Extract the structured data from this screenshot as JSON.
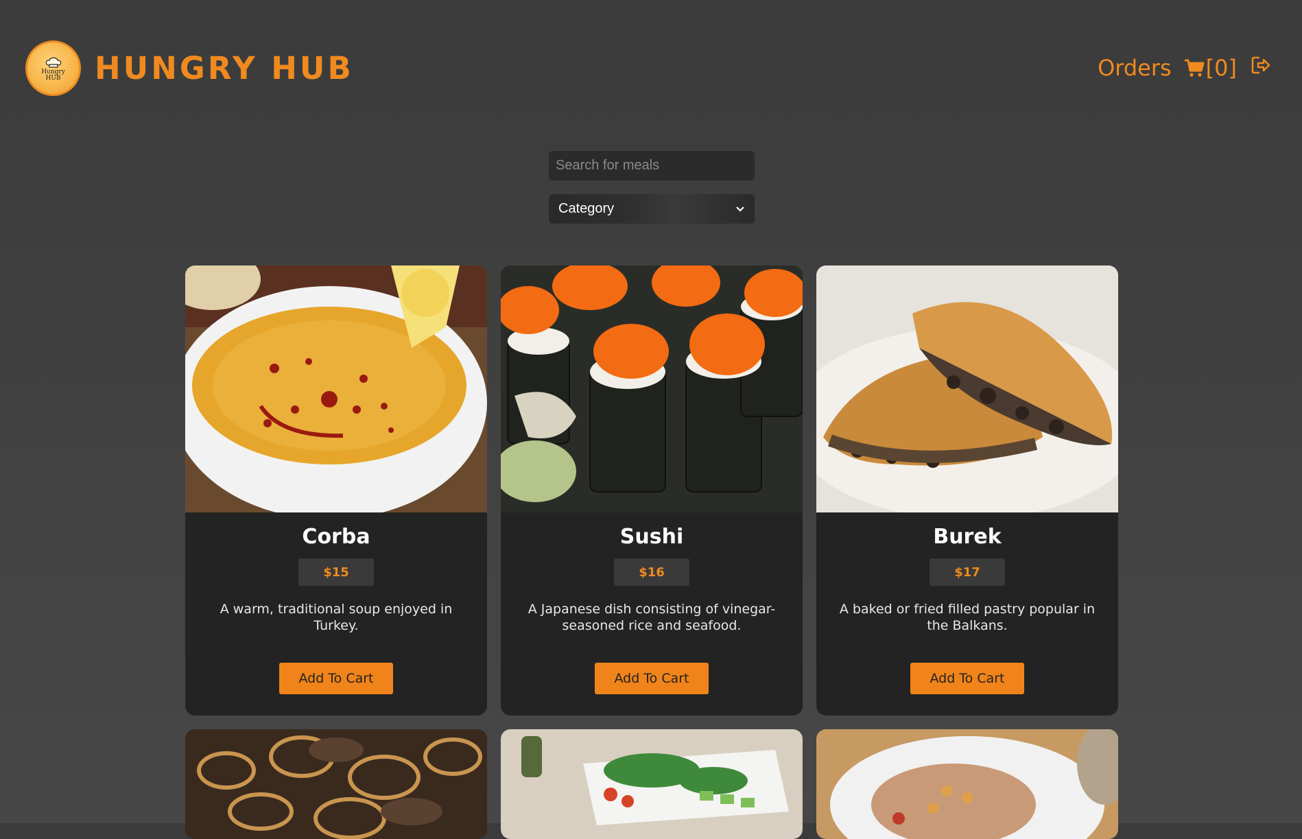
{
  "brand": {
    "title": "HUNGRY HUB",
    "logo_text_1": "Hungry",
    "logo_text_2": "HUB"
  },
  "nav": {
    "orders_label": "Orders",
    "cart_count": "[0]"
  },
  "search": {
    "placeholder": "Search for meals",
    "value": ""
  },
  "category": {
    "selected": "Category"
  },
  "colors": {
    "accent": "#f08a1f",
    "card_bg": "#232323",
    "page_bg": "#404040"
  },
  "meals": [
    {
      "name": "Corba",
      "price": "$15",
      "description": "A warm, traditional soup enjoyed in Turkey.",
      "button": "Add To Cart"
    },
    {
      "name": "Sushi",
      "price": "$16",
      "description": "A Japanese dish consisting of vinegar-seasoned rice and seafood.",
      "button": "Add To Cart"
    },
    {
      "name": "Burek",
      "price": "$17",
      "description": "A baked or fried filled pastry popular in the Balkans.",
      "button": "Add To Cart"
    }
  ]
}
